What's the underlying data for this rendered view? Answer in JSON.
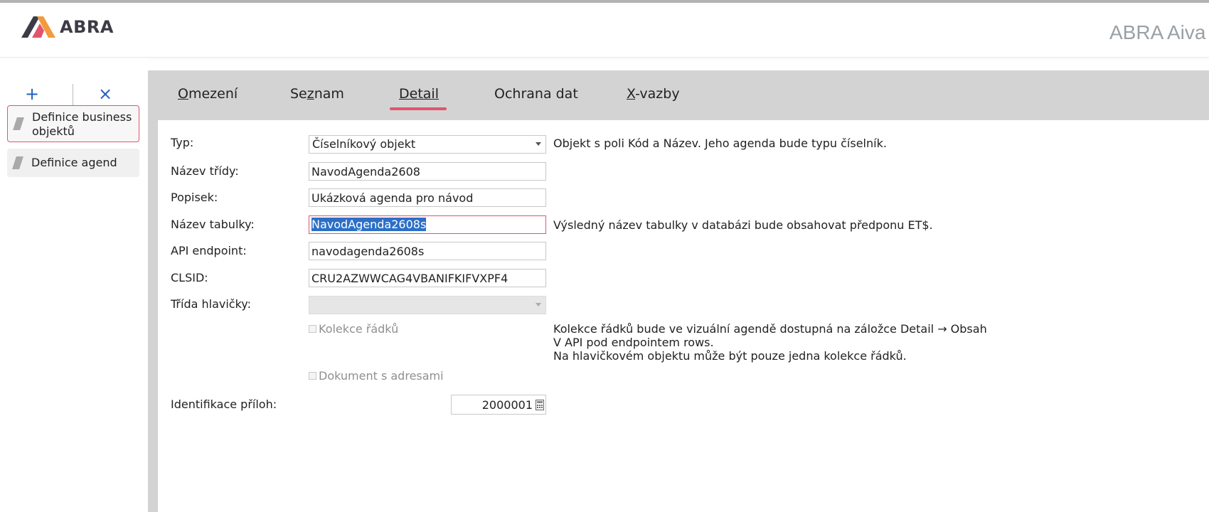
{
  "header": {
    "brand": "ABRA",
    "app_title": "ABRA Aiva"
  },
  "left_panel": {
    "add_label": "+",
    "delete_label": "×",
    "items": [
      {
        "label": "Definice business objektů",
        "active": true
      },
      {
        "label": "Definice agend",
        "active": false
      }
    ]
  },
  "tabs": [
    {
      "label_pre": "",
      "label_u": "O",
      "label_post": "mezení"
    },
    {
      "label_pre": "Se",
      "label_u": "z",
      "label_post": "nam"
    },
    {
      "label_pre": "",
      "label_u": "Detail",
      "label_post": "",
      "active": true
    },
    {
      "label_pre": "Ochrana dat",
      "label_u": "",
      "label_post": ""
    },
    {
      "label_pre": "",
      "label_u": "X",
      "label_post": "-vazby"
    }
  ],
  "form": {
    "typ": {
      "label": "Typ:",
      "value": "Číselníkový objekt",
      "hint": "Objekt s poli Kód a Název. Jeho agenda bude typu číselník."
    },
    "nazev_tridy": {
      "label": "Název třídy:",
      "value": "NavodAgenda2608"
    },
    "popisek": {
      "label": "Popisek:",
      "value": "Ukázková agenda pro návod"
    },
    "nazev_tabulky": {
      "label": "Název tabulky:",
      "value": "NavodAgenda2608s",
      "hint": "Výsledný název tabulky v databázi bude obsahovat předponu ET$."
    },
    "api_endpoint": {
      "label": "API endpoint:",
      "value": "navodagenda2608s"
    },
    "clsid": {
      "label": "CLSID:",
      "value": "CRU2AZWWCAG4VBANIFKIFVXPF4"
    },
    "trida_hlavicky": {
      "label": "Třída hlavičky:",
      "value": ""
    },
    "kolekce_radku": {
      "label": "Kolekce řádků",
      "checked": false,
      "hint_lines": [
        "Kolekce řádků bude ve vizuální agendě dostupná na záložce Detail → Obsah",
        "V API pod endpointem rows.",
        "Na hlavičkovém objektu může být pouze jedna kolekce řádků."
      ]
    },
    "dokument_s_adresami": {
      "label": "Dokument s adresami",
      "checked": false
    },
    "identifikace_priloh": {
      "label": "Identifikace příloh:",
      "value": "2000001"
    }
  },
  "colors": {
    "accent": "#e0556d",
    "action_blue": "#1f5fbf",
    "tab_bar": "#d3d3d3",
    "selection": "#2c6fc7"
  }
}
